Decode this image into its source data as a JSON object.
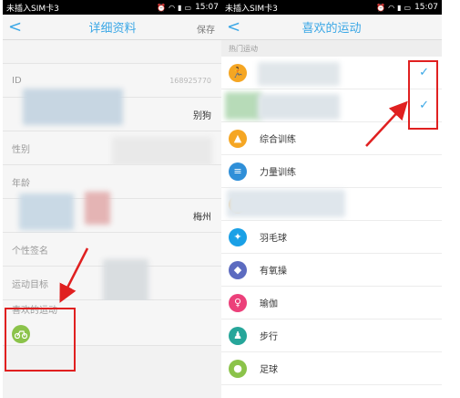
{
  "left": {
    "status": {
      "carrier": "未插入SIM卡3",
      "time": "15:07"
    },
    "nav": {
      "title": "详细资料",
      "action": "保存"
    },
    "rows": {
      "id_label": "ID",
      "id_value": "168925770",
      "nickname_value": "别狗",
      "gender": "性别",
      "age": "年龄",
      "city_value": "梅州",
      "signature": "个性签名",
      "goal": "运动目标",
      "favorite": "喜欢的运动"
    }
  },
  "right": {
    "status": {
      "carrier": "未插入SIM卡3",
      "time": "15:07"
    },
    "nav": {
      "title": "喜欢的运动"
    },
    "section": "热门运动",
    "sports": [
      {
        "label": "综合训练",
        "icon": "training-icon",
        "color": "#f5a623"
      },
      {
        "label": "力量训练",
        "icon": "dumbbell-icon",
        "color": "#2f8fd8"
      },
      {
        "label": "羽毛球",
        "icon": "badminton-icon",
        "color": "#1aa0e6"
      },
      {
        "label": "有氧操",
        "icon": "aerobics-icon",
        "color": "#5c6bc0"
      },
      {
        "label": "瑜伽",
        "icon": "yoga-icon",
        "color": "#ec407a"
      },
      {
        "label": "步行",
        "icon": "walking-icon",
        "color": "#26a69a"
      },
      {
        "label": "足球",
        "icon": "soccer-icon",
        "color": "#8bc34a"
      }
    ]
  }
}
